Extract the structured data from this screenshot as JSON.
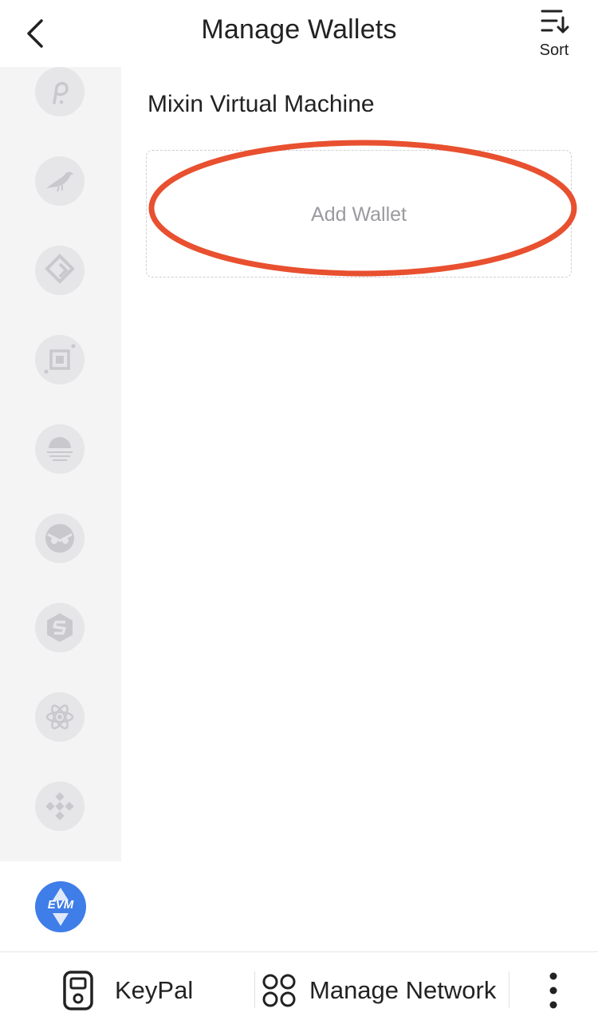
{
  "header": {
    "title": "Manage Wallets",
    "back_icon": "chevron-left-icon",
    "sort_label": "Sort",
    "sort_icon": "sort-icon"
  },
  "sidebar": {
    "items": [
      {
        "icon": "polkadot-icon",
        "selected": false
      },
      {
        "icon": "bird-chain-icon",
        "selected": false
      },
      {
        "icon": "diamond-chain-icon",
        "selected": false
      },
      {
        "icon": "square-chain-icon",
        "selected": false
      },
      {
        "icon": "sunset-chain-icon",
        "selected": false
      },
      {
        "icon": "owl-chain-icon",
        "selected": false
      },
      {
        "icon": "hexagon-s-chain-icon",
        "selected": false
      },
      {
        "icon": "atom-icon",
        "selected": false
      },
      {
        "icon": "bnb-icon",
        "selected": false
      },
      {
        "icon": "evm-icon",
        "label": "EVM",
        "selected": true
      }
    ]
  },
  "main": {
    "section_title": "Mixin Virtual Machine",
    "add_wallet_label": "Add Wallet"
  },
  "bottom_bar": {
    "keypal_label": "KeyPal",
    "manage_network_label": "Manage Network",
    "more_icon": "more-vertical-icon"
  },
  "colors": {
    "highlight": "#e8502f",
    "evm_blue": "#3f7de8",
    "sidebar_bg": "#f4f4f5"
  }
}
